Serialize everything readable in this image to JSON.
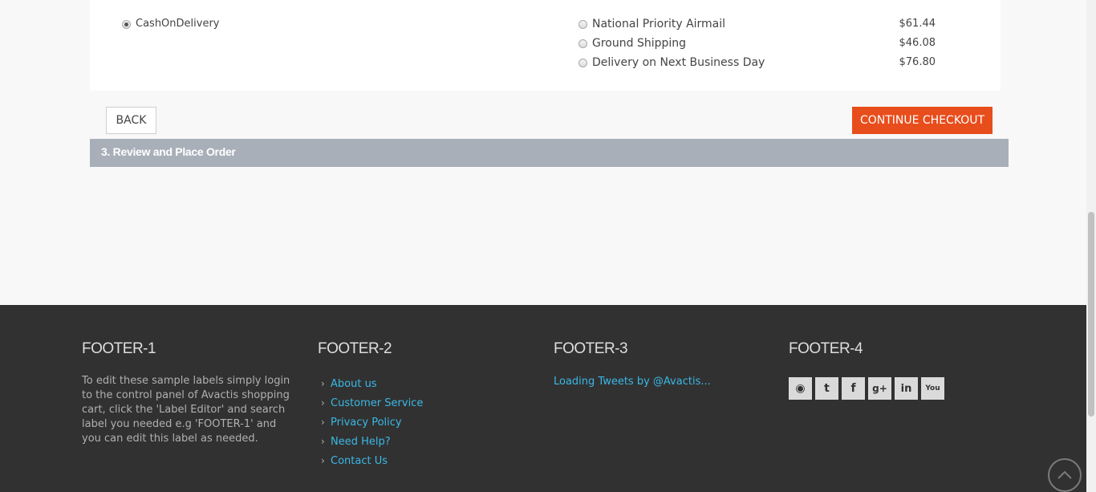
{
  "payment": {
    "option_label": "CashOnDelivery",
    "selected": true
  },
  "shipping": {
    "options": [
      {
        "label": "National Priority Airmail",
        "price": "$61.44"
      },
      {
        "label": "Ground Shipping",
        "price": "$46.08"
      },
      {
        "label": "Delivery on Next Business Day",
        "price": "$76.80"
      }
    ]
  },
  "buttons": {
    "back": "BACK",
    "continue": "CONTINUE CHECKOUT"
  },
  "step3": {
    "title": "3. Review and Place Order"
  },
  "footer": {
    "col1": {
      "heading": "FOOTER-1",
      "text": "To edit these sample labels simply login to the control panel of Avactis shopping cart, click the 'Label Editor' and search label you needed e.g 'FOOTER-1' and you can edit this label as needed."
    },
    "col2": {
      "heading": "FOOTER-2",
      "links": [
        "About us",
        "Customer Service",
        "Privacy Policy",
        "Need Help?",
        "Contact Us"
      ]
    },
    "col3": {
      "heading": "FOOTER-3",
      "tweets": "Loading Tweets by @Avactis..."
    },
    "col4": {
      "heading": "FOOTER-4",
      "social": [
        {
          "icon": "rss-icon",
          "glyph": "◉"
        },
        {
          "icon": "twitter-icon",
          "glyph": "t"
        },
        {
          "icon": "facebook-icon",
          "glyph": "f"
        },
        {
          "icon": "google-plus-icon",
          "glyph": "g+"
        },
        {
          "icon": "linkedin-icon",
          "glyph": "in"
        },
        {
          "icon": "youtube-icon",
          "glyph": "You"
        }
      ]
    }
  },
  "colors": {
    "accent": "#e84d1c",
    "link": "#3ab8e6",
    "footer_bg": "#313131",
    "step_bar": "#a8afb8"
  }
}
